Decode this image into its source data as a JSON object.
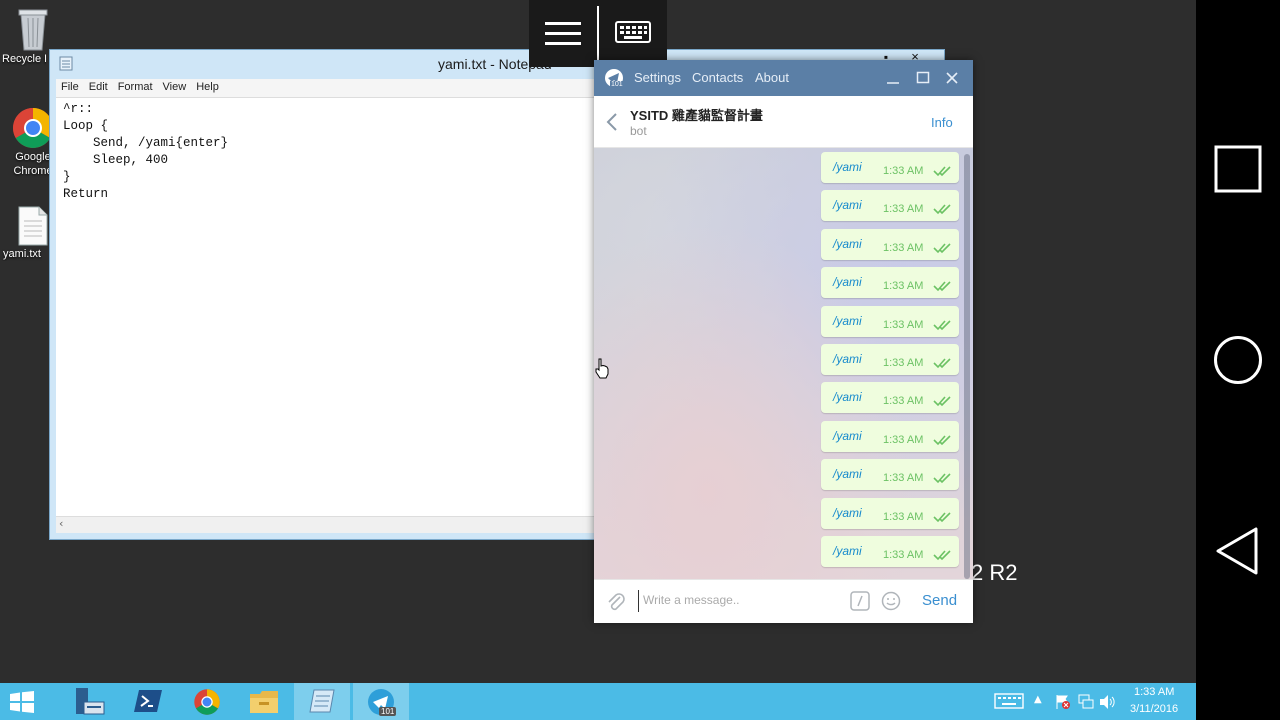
{
  "desktop": {
    "icons": [
      {
        "label": "Recycle Bin",
        "icon": "recycle-bin-icon"
      },
      {
        "label": "Google Chrome",
        "icon": "chrome-icon"
      },
      {
        "label": "yami.txt",
        "icon": "text-file-icon"
      }
    ],
    "watermark": "2 R2"
  },
  "notepad": {
    "title": "yami.txt - Notepad",
    "menu": [
      "File",
      "Edit",
      "Format",
      "View",
      "Help"
    ],
    "content": "^r::\nLoop {\n    Send, /yami{enter}\n    Sleep, 400\n}\nReturn"
  },
  "telegram": {
    "menu": [
      "Settings",
      "Contacts",
      "About"
    ],
    "badge": "101",
    "chat": {
      "name": "YSITD 雞產貓監督計畫",
      "status": "bot",
      "info_label": "Info"
    },
    "messages": [
      {
        "text": "/yami",
        "time": "1:33 AM"
      },
      {
        "text": "/yami",
        "time": "1:33 AM"
      },
      {
        "text": "/yami",
        "time": "1:33 AM"
      },
      {
        "text": "/yami",
        "time": "1:33 AM"
      },
      {
        "text": "/yami",
        "time": "1:33 AM"
      },
      {
        "text": "/yami",
        "time": "1:33 AM"
      },
      {
        "text": "/yami",
        "time": "1:33 AM"
      },
      {
        "text": "/yami",
        "time": "1:33 AM"
      },
      {
        "text": "/yami",
        "time": "1:33 AM"
      },
      {
        "text": "/yami",
        "time": "1:33 AM"
      },
      {
        "text": "/yami",
        "time": "1:33 AM"
      }
    ],
    "compose": {
      "placeholder": "Write a message..",
      "send_label": "Send"
    }
  },
  "taskbar": {
    "apps": [
      "start-icon",
      "server-manager-icon",
      "powershell-icon",
      "chrome-icon",
      "file-explorer-icon",
      "notepad-icon",
      "telegram-icon"
    ],
    "telegram_badge": "101",
    "clock_time": "1:33 AM",
    "clock_date": "3/11/2016"
  },
  "colors": {
    "telegram_header": "#5b7fa6",
    "message_bubble": "#effdde",
    "taskbar": "#4bbbe6"
  }
}
